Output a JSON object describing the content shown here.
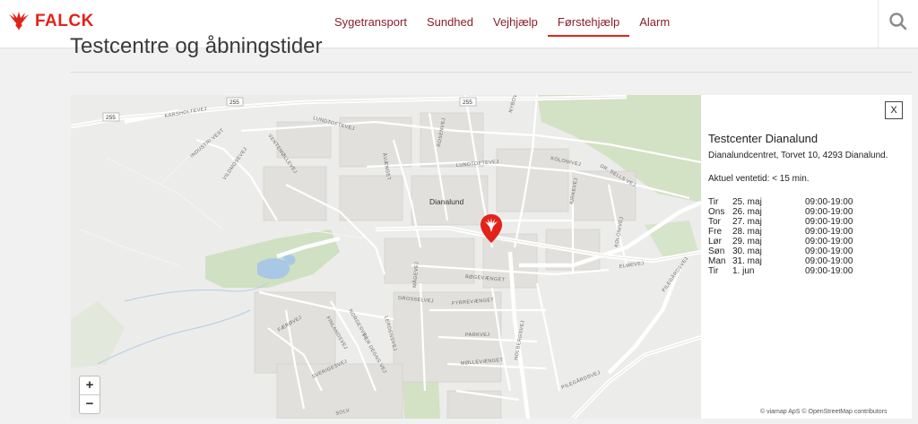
{
  "brand": {
    "name": "FALCK",
    "color": "#e2231a"
  },
  "nav": [
    {
      "label": "Sygetransport"
    },
    {
      "label": "Sundhed"
    },
    {
      "label": "Vejhjælp"
    },
    {
      "label": "Førstehjælp",
      "active": true
    },
    {
      "label": "Alarm"
    }
  ],
  "icons": {
    "search": "search-icon",
    "pin": "falck-pin-icon"
  },
  "page": {
    "title": "Testcentre og åbningstider"
  },
  "map": {
    "place": "Dianalund",
    "roads": [
      "KARSHOLTEVEJ",
      "INDUSTRI VEST",
      "LUNDTOFTEVEJ",
      "VENTEMØLLEVEJ",
      "ROSENVEJ",
      "NYBOVEJ",
      "ÅVÆNGET",
      "LUNDTOFTEVEJ",
      "KOLONIVEJ",
      "DR. SELLS VEJ",
      "KIRKEVEJ",
      "KOLONIVEJ",
      "ELMEVEJ",
      "PILEGÅRDSVEJ",
      "BØGEVÆNGET",
      "DROSSELVEJ",
      "MÅGEVEJ",
      "FYRREVÆNGET",
      "PARKVEJ",
      "HOLBERGSVEJ",
      "MØLLEVÆNGET",
      "FÆRØVEJ",
      "FINLANDSVEJ",
      "NORGESVEJ",
      "LERDENSVEJ",
      "PER DEGNS VEJ",
      "SVERIGESVEJ",
      "PILEGÅRDSVEJ",
      "SOLV",
      "VILDMOSEVEJ"
    ],
    "route_numbers": [
      "255",
      "255",
      "255"
    ],
    "zoom_in": "+",
    "zoom_out": "−"
  },
  "panel": {
    "close_label": "X",
    "title": "Testcenter Dianalund",
    "address": "Dianalundcentret, Torvet 10, 4293 Dianalund.",
    "wait": "Aktuel ventetid: < 15 min.",
    "hours": [
      {
        "day": "Tir",
        "date": "25. maj",
        "time": "09:00-19:00"
      },
      {
        "day": "Ons",
        "date": "26. maj",
        "time": "09:00-19:00"
      },
      {
        "day": "Tor",
        "date": "27. maj",
        "time": "09:00-19:00"
      },
      {
        "day": "Fre",
        "date": "28. maj",
        "time": "09:00-19:00"
      },
      {
        "day": "Lør",
        "date": "29. maj",
        "time": "09:00-19:00"
      },
      {
        "day": "Søn",
        "date": "30. maj",
        "time": "09:00-19:00"
      },
      {
        "day": "Man",
        "date": "31. maj",
        "time": "09:00-19:00"
      },
      {
        "day": "Tir",
        "date": "1. jun",
        "time": "09:00-19:00"
      }
    ],
    "attribution": "© viamap ApS © OpenStreetMap contributors"
  }
}
